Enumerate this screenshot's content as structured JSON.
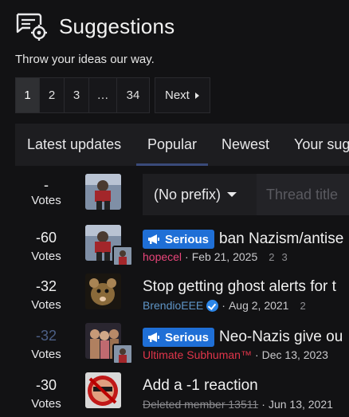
{
  "header": {
    "title": "Suggestions",
    "subtitle": "Throw your ideas our way."
  },
  "pagination": {
    "pages": [
      "1",
      "2",
      "3",
      "…",
      "34"
    ],
    "current": "1",
    "next_label": "Next"
  },
  "tabs": [
    {
      "label": "Latest updates"
    },
    {
      "label": "Popular"
    },
    {
      "label": "Newest"
    },
    {
      "label": "Your sug"
    }
  ],
  "active_tab": "Popular",
  "filter": {
    "prefix": "(No prefix)",
    "title_placeholder": "Thread title"
  },
  "header_votes": {
    "value": "-",
    "label": "Votes"
  },
  "threads": [
    {
      "votes": "-60",
      "votes_label": "Votes",
      "prefix": "Serious",
      "title": "ban Nazism/antise",
      "author": "hopecel",
      "date": "Feb 21, 2025",
      "pages": [
        "2",
        "3"
      ]
    },
    {
      "votes": "-32",
      "votes_label": "Votes",
      "prefix": "",
      "title": "Stop getting ghost alerts for t",
      "author": "BrendioEEE",
      "date": "Aug 2, 2021",
      "pages": [
        "2"
      ]
    },
    {
      "votes": "-32",
      "votes_label": "Votes",
      "prefix": "Serious",
      "title": "Neo-Nazis give ou",
      "author": "Ultimate Subhuman™",
      "date": "Dec 13, 2023",
      "pages": []
    },
    {
      "votes": "-30",
      "votes_label": "Votes",
      "prefix": "",
      "title": "Add a -1 reaction",
      "author": "Deleted member 13511",
      "date": "Jun 13, 2021",
      "pages": []
    }
  ],
  "meta_separator": "·",
  "colors": {
    "background": "#121214",
    "accent": "#1f6fd6",
    "tab_underline": "#3a4a7a"
  }
}
